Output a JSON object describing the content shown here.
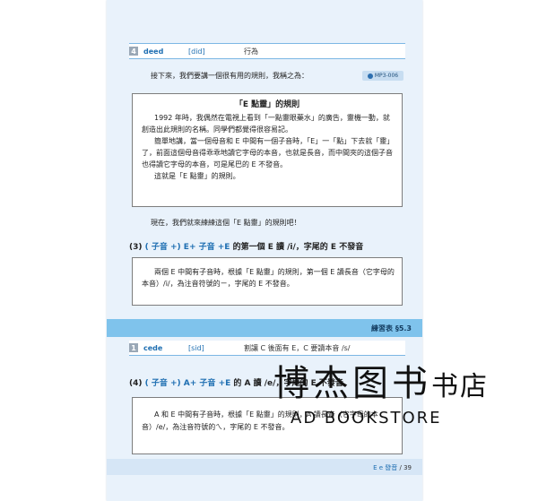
{
  "vocab1": {
    "num": "4",
    "word": "deed",
    "ipa": "[did]",
    "meaning": "行為"
  },
  "intro": "接下來，我們要講一個很有用的規則，我稱之為：",
  "mp3_label": "MP3-006",
  "box": {
    "title": "「E 點靈」的規則",
    "p1": "1992 年時，我偶然在電視上看到「一點靈眼藥水」的廣告，靈機一動，就創造出此規則的名稱。同學們都覺得很容易記。",
    "p2": "簡單地講，當一個母音和 E 中間有一個子音時，「E」一「點」下去就「靈」了，前面這個母音得乖乖地讀它字母的本音，也就是長音，而中間夾的這個子音也得讀它字母的本音，可是尾巴的 E 不發音。",
    "p3": "這就是「E 點靈」的規則。"
  },
  "practice_intro": "現在，我們就來練練這個「E 點靈」的規則吧！",
  "rule3": {
    "prefix": "(3) ",
    "blue": "( 子音 +) E+ 子音 +E",
    "rest": " 的第一個 E 讀 /i/，字尾的 E 不發音"
  },
  "box2_text": "兩個 E 中間有子音時，根據「E 點靈」的規則，第一個 E 讀長音（它字母的本音）/i/，為注音符號的ㄧ，字尾的 E 不發音。",
  "exercise_label": "練習表 §5.3",
  "vocab2": {
    "num": "1",
    "word": "cede",
    "ipa": "[sid]",
    "meaning": "割讓 C 後面有 E，C 要讀本音 /s/"
  },
  "rule4": {
    "prefix": "(4) ",
    "blue": "( 子音 +) A+ 子音 +E",
    "rest": " 的 A 讀 /e/，字尾的 E 不發音"
  },
  "box3_text": "A 和 E 中間有子音時，根據「E 點靈」的規則，A 讀長音（它字母的本音）/e/，為注音符號的ㄟ，字尾的 E 不發音。",
  "footer": {
    "section": "E e 發音",
    "page": " / 39"
  },
  "watermark": {
    "cn": "博杰图书",
    "cn_small": "书店",
    "en": "AD BOOKSTORE"
  }
}
